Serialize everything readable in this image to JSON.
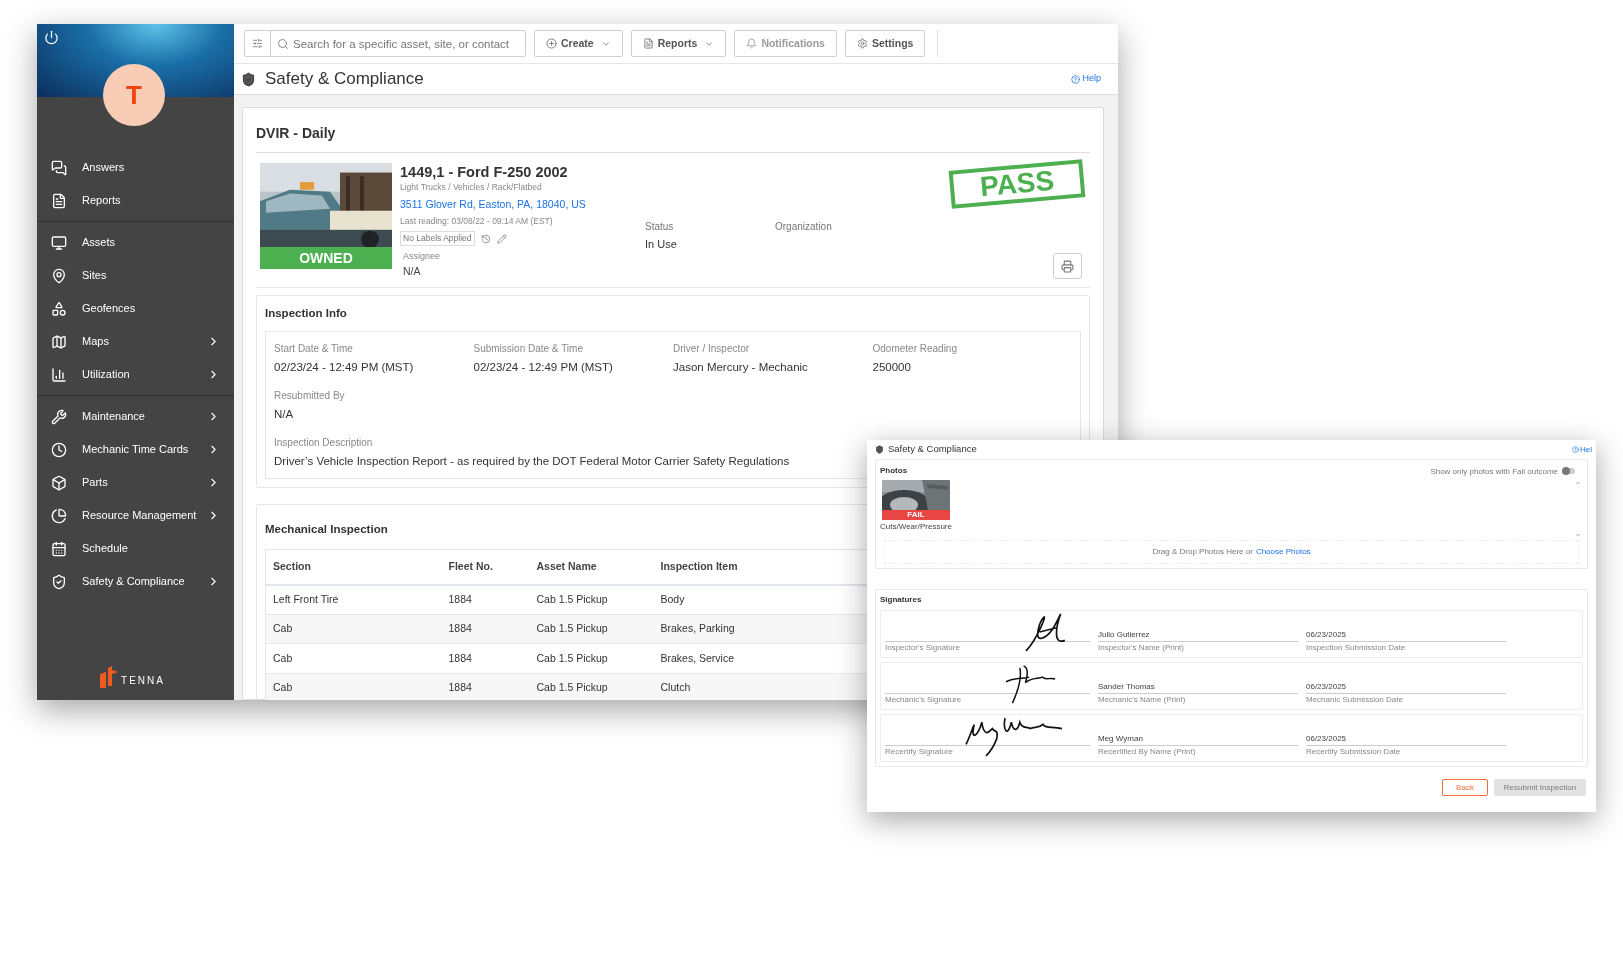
{
  "main_window": {
    "sidebar": {
      "avatar_initial": "T",
      "logo_text": "TENNA",
      "sections": [
        [
          {
            "label": "Answers",
            "has_submenu": false
          },
          {
            "label": "Reports",
            "has_submenu": false
          }
        ],
        [
          {
            "label": "Assets",
            "has_submenu": false
          },
          {
            "label": "Sites",
            "has_submenu": false
          },
          {
            "label": "Geofences",
            "has_submenu": false
          },
          {
            "label": "Maps",
            "has_submenu": true
          },
          {
            "label": "Utilization",
            "has_submenu": true
          }
        ],
        [
          {
            "label": "Maintenance",
            "has_submenu": true
          },
          {
            "label": "Mechanic Time Cards",
            "has_submenu": true
          },
          {
            "label": "Parts",
            "has_submenu": true
          },
          {
            "label": "Resource Management",
            "has_submenu": true
          },
          {
            "label": "Schedule",
            "has_submenu": false
          },
          {
            "label": "Safety & Compliance",
            "has_submenu": true
          }
        ]
      ]
    },
    "toolbar": {
      "search_placeholder": "Search for a specific asset, site, or contact",
      "buttons": [
        {
          "label": "Create",
          "dropdown": true,
          "disabled": false
        },
        {
          "label": "Reports",
          "dropdown": true,
          "disabled": false
        },
        {
          "label": "Notifications",
          "dropdown": false,
          "disabled": true
        },
        {
          "label": "Settings",
          "dropdown": false,
          "disabled": false
        }
      ]
    },
    "page_title": "Safety & Compliance",
    "help": "Help",
    "card": {
      "title": "DVIR - Daily",
      "asset": {
        "name": "1449,1 - Ford F-250 2002",
        "category": "Light Trucks / Vehicles / Rack/Flatbed",
        "address": "3511 Glover Rd, Easton, PA, 18040, US",
        "last_reading": "Last reading: 03/08/22 - 09:14 AM (EST)",
        "ownership": "OWNED",
        "labels": "No Labels Applied",
        "assignee_label": "Assignee",
        "assignee": "N/A",
        "status_label": "Status",
        "status": "In Use",
        "organization_label": "Organization",
        "result": "PASS"
      },
      "inspection_info": {
        "title": "Inspection Info",
        "fields": [
          {
            "label": "Start Date & Time",
            "value": "02/23/24 - 12:49 PM (MST)"
          },
          {
            "label": "Submission Date & Time",
            "value": "02/23/24 - 12:49 PM (MST)"
          },
          {
            "label": "Driver / Inspector",
            "value": "Jason Mercury - Mechanic"
          },
          {
            "label": "Odometer Reading",
            "value": "250000"
          }
        ],
        "row_fields": [
          {
            "label": "Resubmitted By",
            "value": "N/A"
          },
          {
            "label": "Inspection Description",
            "value": "Driver’s Vehicle Inspection Report - as required by the DOT Federal Motor Carrier Safety Regulations"
          }
        ]
      },
      "mechanical_inspection": {
        "title": "Mechanical Inspection",
        "columns": [
          "Section",
          "Fleet No.",
          "Asset Name",
          "Inspection Item"
        ],
        "rows": [
          [
            "Left Front Tire",
            "1884",
            "Cab 1.5 Pickup",
            "Body"
          ],
          [
            "Cab",
            "1884",
            "Cab 1.5 Pickup",
            "Brakes, Parking"
          ],
          [
            "Cab",
            "1884",
            "Cab 1.5 Pickup",
            "Brakes, Service"
          ],
          [
            "Cab",
            "1884",
            "Cab 1.5 Pickup",
            "Clutch"
          ]
        ]
      }
    }
  },
  "overlay_window": {
    "title": "Safety & Compliance",
    "help": "Hel",
    "photos": {
      "title": "Photos",
      "toggle_label": "Show only photos with Fail outcome",
      "toggle_on": false,
      "items": [
        {
          "outcome": "FAIL",
          "caption": "Cuts/Wear/Pressure"
        }
      ],
      "drop_text": "Drag & Drop Photos Here or",
      "drop_link": "Choose Photos"
    },
    "signatures": {
      "title": "Signatures",
      "rows": [
        {
          "signature_label": "Inspector's Signature",
          "name": "Julio Gutierrez",
          "name_label": "Inspector's Name (Print)",
          "date": "06/23/2025",
          "date_label": "Inspection Submission Date"
        },
        {
          "signature_label": "Mechanic's Signature",
          "name": "Sander Thomas",
          "name_label": "Mechanic's Name (Print)",
          "date": "06/23/2025",
          "date_label": "Mechanic Submission Date"
        },
        {
          "signature_label": "Recertify Signature",
          "name": "Meg Wyman",
          "name_label": "Recertified By Name (Print)",
          "date": "06/23/2025",
          "date_label": "Recertify Submission Date"
        }
      ]
    },
    "buttons": [
      {
        "label": "Back",
        "kind": "outline",
        "disabled": false
      },
      {
        "label": "Resubmit Inspection",
        "kind": "filled",
        "disabled": true
      }
    ]
  }
}
